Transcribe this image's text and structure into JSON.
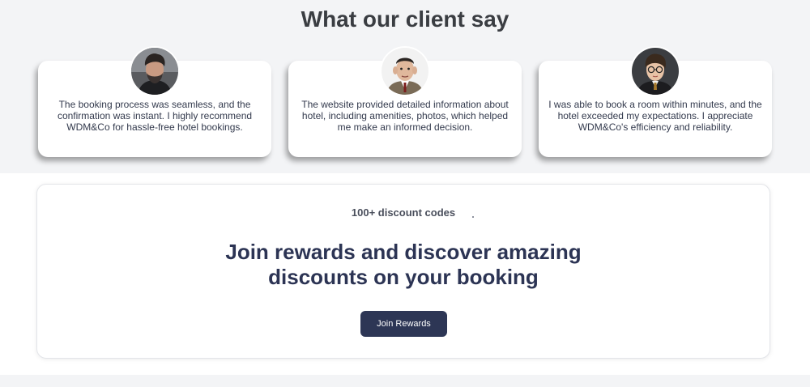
{
  "testimonials": {
    "title": "What our client say",
    "cards": [
      {
        "quote": "The booking process was seamless, and the confirmation was instant. I highly recommend WDM&Co for hassle-free hotel bookings.",
        "avatar_icon": "man-beard-avatar-icon"
      },
      {
        "quote": "The website provided detailed information about hotel, including amenities, photos, which helped me make an informed decision.",
        "avatar_icon": "man-suit-avatar-icon"
      },
      {
        "quote": "I was able to book a room within minutes, and the hotel exceeded my expectations. I appreciate WDM&Co's efficiency and reliability.",
        "avatar_icon": "boy-glasses-avatar-icon"
      }
    ]
  },
  "rewards": {
    "eyebrow": "100+ discount codes",
    "headline": "Join rewards and discover amazing discounts on your booking",
    "cta_label": "Join Rewards"
  },
  "colors": {
    "section_bg": "#f3f4f6",
    "card_bg": "#ffffff",
    "heading": "#3a3d42",
    "headline": "#2c3454",
    "button": "#2d3655"
  }
}
